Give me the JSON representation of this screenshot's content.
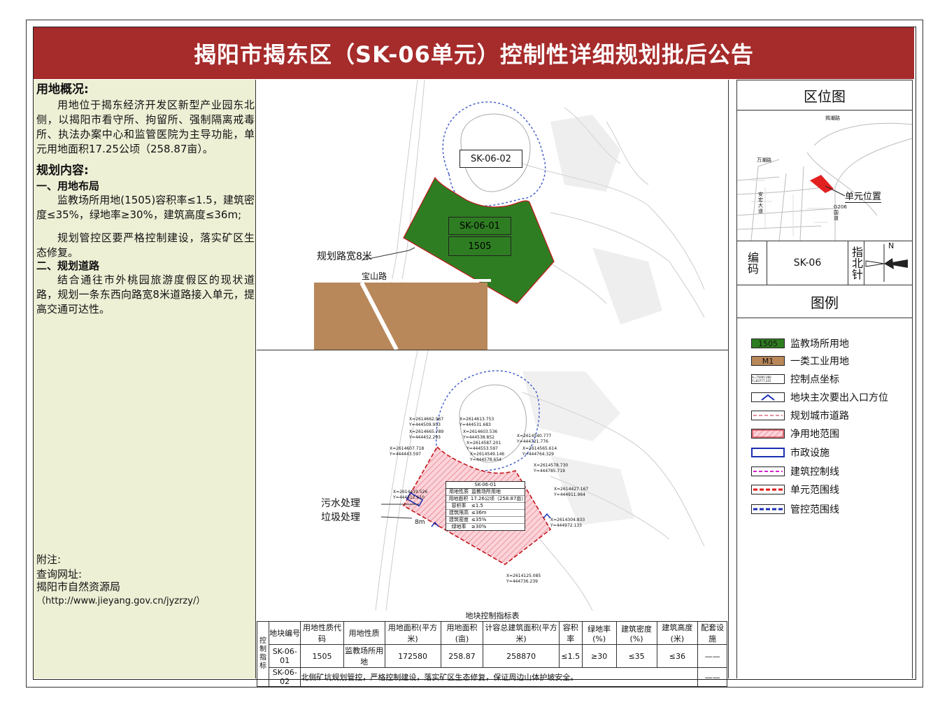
{
  "title": "揭阳市揭东区（SK-06单元）控制性详细规划批后公告",
  "left": {
    "overview_heading": "用地概况:",
    "overview_text": "用地位于揭东经济开发区新型产业园东北侧，以揭阳市看守所、拘留所、强制隔离戒毒所、执法办案中心和监管医院为主导功能，单元用地面积17.25公顷（258.87亩）。",
    "plan_heading": "规划内容:",
    "section1_heading": "一、用地布局",
    "section1_p1": "监教场所用地(1505)容积率≤1.5，建筑密度≤35%，绿地率≥30%，建筑高度≤36m;",
    "section1_p2": "规划管控区要严格控制建设，落实矿区生态修复。",
    "section2_heading": "二、规划道路",
    "section2_p1": "结合通往市外桃园旅游度假区的现状道路，规划一条东西向路宽8米道路接入单元，提高交通可达性。",
    "note_heading": "附注:",
    "note_line1": "查询网址:",
    "note_line2": "揭阳市自然资源局",
    "note_line3": "（http://www.jieyang.gov.cn/jyzrzy/）"
  },
  "map_top": {
    "label_sk0602": "SK-06-02",
    "label_sk0601": "SK-06-01",
    "label_code": "1505",
    "road_label": "规划路宽8米",
    "street_label": "宝山路",
    "colors": {
      "green": "#2f7d22",
      "brown": "#b8875a"
    }
  },
  "map_bottom": {
    "label_sewage": "污水处理",
    "label_garbage": "垃圾处理",
    "label_8m": "8m",
    "block_table": {
      "title": "SK-06-01",
      "rows": [
        [
          "用地性质",
          "监教场所用地"
        ],
        [
          "用地面积",
          "17.26公顷（258.87亩）"
        ],
        [
          "容积率",
          "≤1.5"
        ],
        [
          "建筑限高",
          "≤36m"
        ],
        [
          "建筑密度",
          "≤35%"
        ],
        [
          "绿地率",
          "≥30%"
        ]
      ]
    },
    "coords": [
      "X=2614662.967 Y=444509.953",
      "X=2614665.789 Y=444452.293",
      "X=2614607.718 Y=444443.597",
      "X=2614613.753 Y=444531.683",
      "X=2614603.536 Y=444538.852",
      "X=2614587.201 Y=444553.597",
      "X=2614549.146 Y=444578.654",
      "X=2614540.777 Y=444721.776",
      "X=2614565.614 Y=444764.329",
      "X=2614578.730 Y=444785.719",
      "X=2614427.167 Y=444911.964",
      "X=2614419.526 Y=444312.610",
      "X=2614304.833 Y=444972.133",
      "X=2614125.085 Y=444736.239"
    ]
  },
  "right": {
    "location_title": "区位图",
    "location_label": "单元位置",
    "road_a": "揭潮路",
    "road_b": "万潮路",
    "road_c": "安宏大道",
    "road_d": "G206国道",
    "code_label": "编码",
    "code_value": "SK-06",
    "north_label": "指北针",
    "north_letter": "N",
    "legend_title": "图例",
    "legend": [
      {
        "key": "1505",
        "label": "监教场所用地",
        "color": "#2f7d22"
      },
      {
        "key": "M1",
        "label": "一类工业用地",
        "color": "#b8875a"
      },
      {
        "key": "X=75995.080 Y=83777.225",
        "label": "控制点坐标"
      },
      {
        "key": "",
        "label": "地块主次要出入口方位"
      },
      {
        "key": "",
        "label": "规划城市道路"
      },
      {
        "key": "",
        "label": "净用地范围"
      },
      {
        "key": "",
        "label": "市政设施"
      },
      {
        "key": "",
        "label": "建筑控制线"
      },
      {
        "key": "",
        "label": "单元范围线"
      },
      {
        "key": "",
        "label": "管控范围线"
      }
    ]
  },
  "indicators": {
    "caption": "地块控制指标表",
    "side_label": "控制指标",
    "headers": [
      "地块编号",
      "用地性质代码",
      "用地性质",
      "用地面积(平方米)",
      "用地面积(亩)",
      "计容总建筑面积(平方米)",
      "容积率",
      "绿地率(%)",
      "建筑密度(%)",
      "建筑高度(米)",
      "配套设施"
    ],
    "row1": [
      "SK-06-01",
      "1505",
      "监教场所用地",
      "172580",
      "258.87",
      "258870",
      "≤1.5",
      "≥30",
      "≤35",
      "≤36",
      "——"
    ],
    "row2_id": "SK-06-02",
    "row2_text": "北侧矿坑规划管控，严格控制建设，落实矿区生态修复，保证周边山体护坡安全。",
    "row2_last": "——"
  }
}
